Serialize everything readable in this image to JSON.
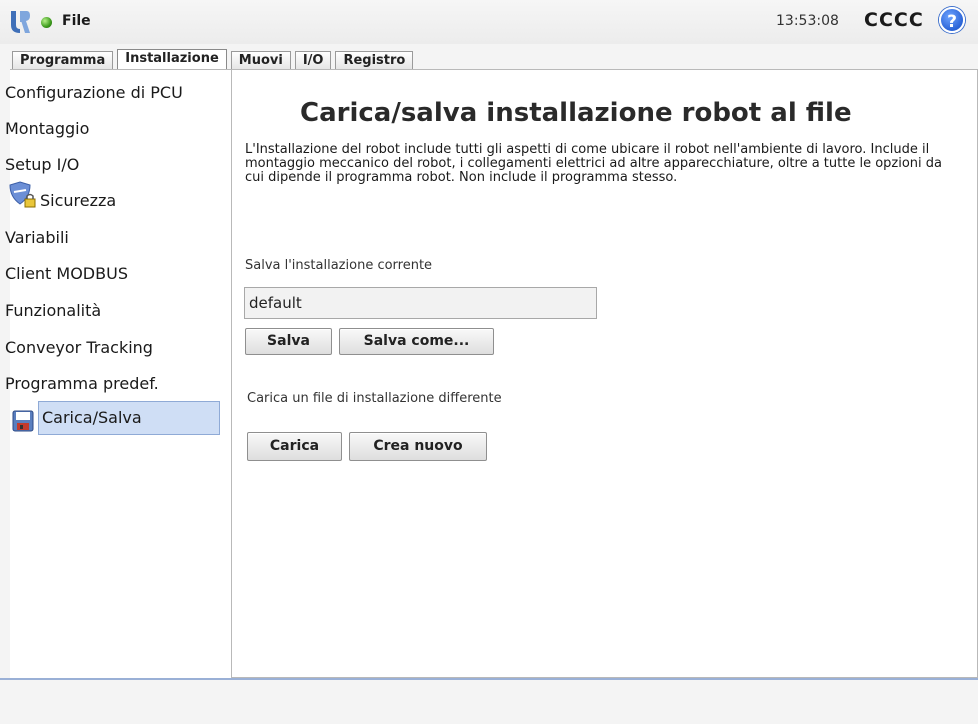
{
  "topbar": {
    "file_label": "File",
    "clock": "13:53:08",
    "robot_name": "CCCC",
    "help_glyph": "?"
  },
  "tabs": [
    {
      "label": "Programma"
    },
    {
      "label": "Installazione"
    },
    {
      "label": "Muovi"
    },
    {
      "label": "I/O"
    },
    {
      "label": "Registro"
    }
  ],
  "sidebar": {
    "items": [
      {
        "label": "Configurazione di PCU"
      },
      {
        "label": "Montaggio"
      },
      {
        "label": "Setup I/O"
      },
      {
        "label": "Sicurezza"
      },
      {
        "label": "Variabili"
      },
      {
        "label": "Client MODBUS"
      },
      {
        "label": "Funzionalità"
      },
      {
        "label": "Conveyor Tracking"
      },
      {
        "label": "Programma predef."
      },
      {
        "label": "Carica/Salva"
      }
    ]
  },
  "main": {
    "title": "Carica/salva installazione robot al file",
    "description": "L'Installazione del robot include tutti gli aspetti di come ubicare il robot nell'ambiente di lavoro. Include il montaggio meccanico del robot, i collegamenti elettrici ad altre apparecchiature, oltre a tutte le opzioni da cui dipende il programma robot. Non include il programma stesso.",
    "save_section_label": "Salva l'installazione corrente",
    "installation_name": "default",
    "save_label": "Salva",
    "save_as_label": "Salva come...",
    "load_section_label": "Carica un file di installazione differente",
    "load_label": "Carica",
    "new_label": "Crea nuovo"
  },
  "icons": {
    "logo": "universal-robots-logo",
    "status": "status-dot-icon",
    "help": "help-icon",
    "safety": "shield-lock-icon",
    "save": "floppy-disk-icon"
  },
  "colors": {
    "selection": "#cfdef5",
    "status_green": "#3c9a1c",
    "help_blue": "#2a63d6"
  }
}
